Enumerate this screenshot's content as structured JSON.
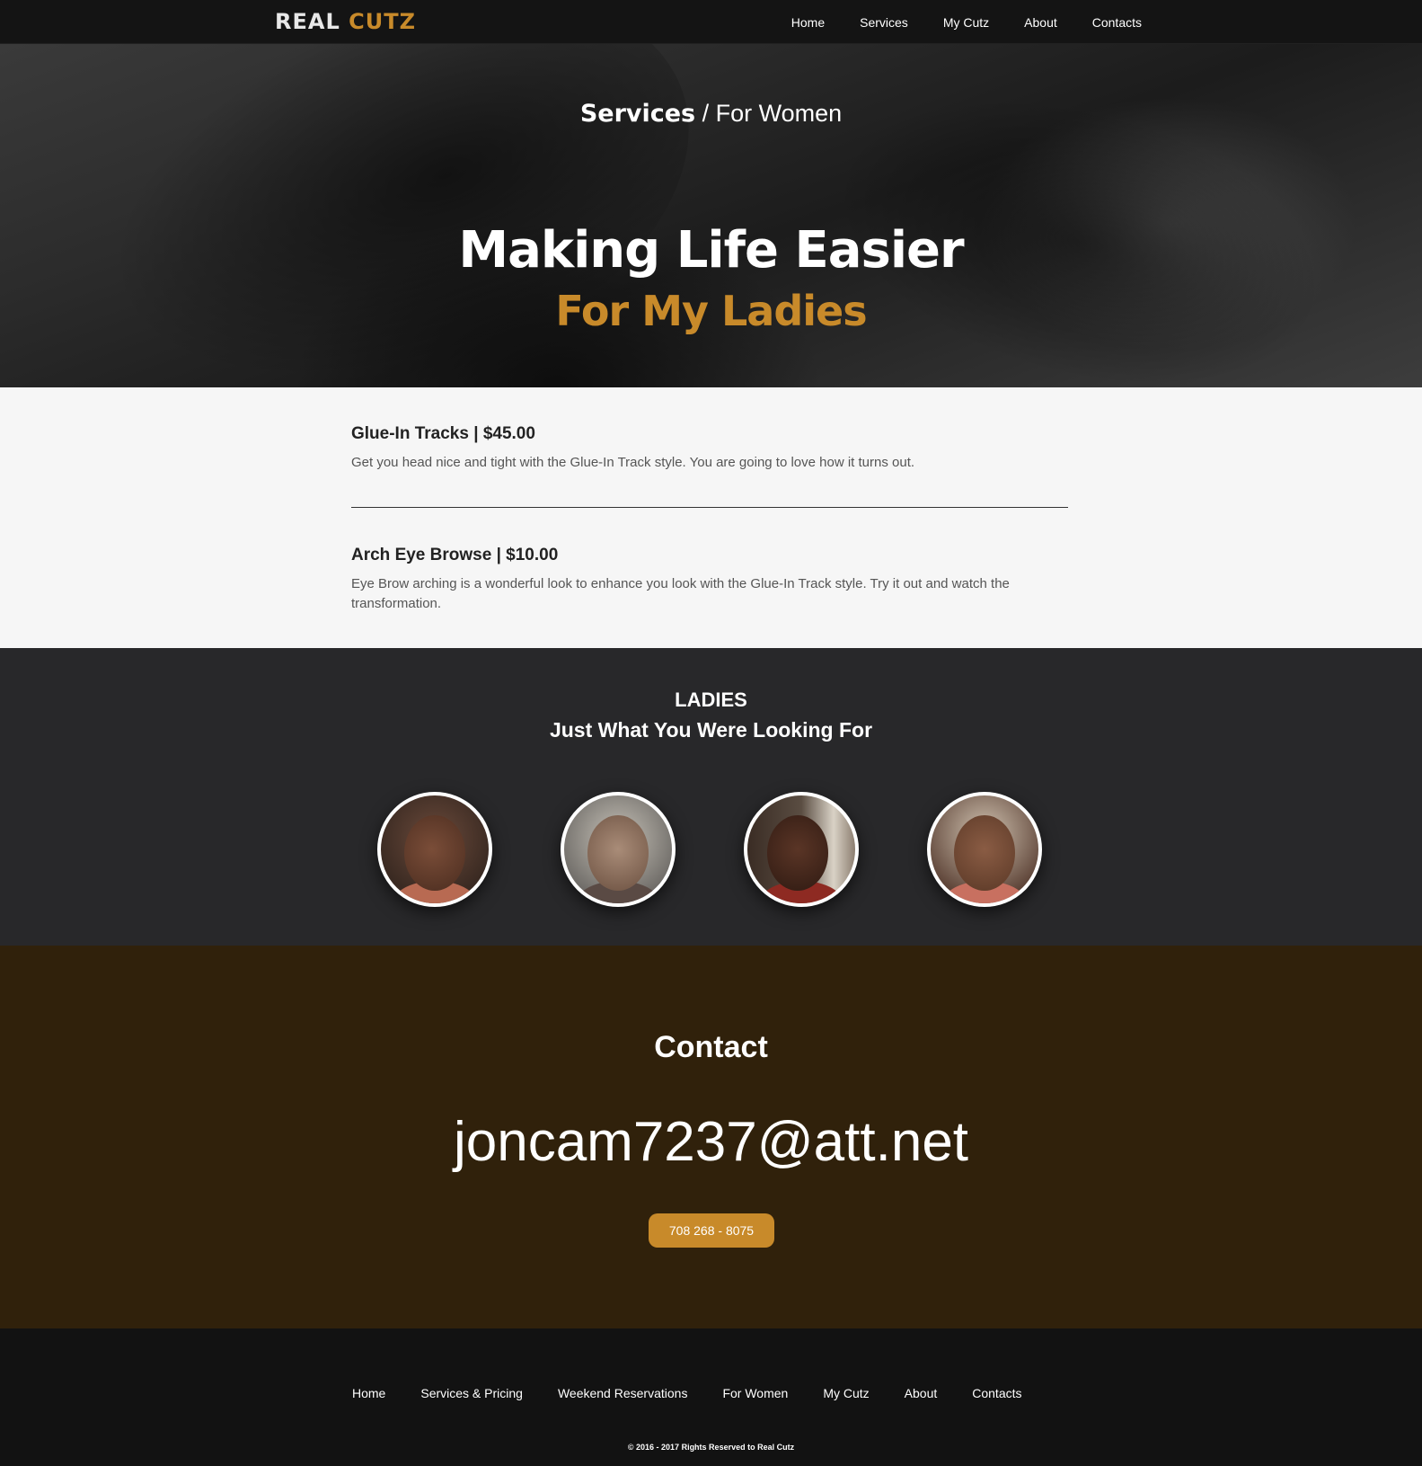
{
  "brand": {
    "word1": "REAL",
    "word2": "CUTZ"
  },
  "nav": [
    "Home",
    "Services",
    "My Cutz",
    "About",
    "Contacts"
  ],
  "hero": {
    "crumb_bold": "Services",
    "crumb_rest": " / For Women",
    "title": "Making Life Easier",
    "subtitle": "For My Ladies"
  },
  "services": [
    {
      "title": "Glue-In Tracks | $45.00",
      "desc": "Get you head nice and tight with the Glue-In Track style. You are going to love how it turns out."
    },
    {
      "title": "Arch Eye Browse | $10.00",
      "desc": "Eye Brow arching is a wonderful look to enhance you look with the Glue-In Track style. Try it out and watch the transformation."
    }
  ],
  "gallery": {
    "heading": "LADIES",
    "subheading": "Just What You Were Looking For"
  },
  "contact": {
    "heading": "Contact",
    "email": "joncam7237@att.net",
    "phone": "708 268 - 8075"
  },
  "footer": {
    "links": [
      "Home",
      "Services & Pricing",
      "Weekend Reservations",
      "For Women",
      "My Cutz",
      "About",
      "Contacts"
    ],
    "copyright": "© 2016 - 2017 Rights Reserved to Real Cutz"
  },
  "colors": {
    "accent": "#c88a2a",
    "contact_bg": "#30210b",
    "gallery_bg": "#28282a",
    "nav_bg": "#141414"
  }
}
